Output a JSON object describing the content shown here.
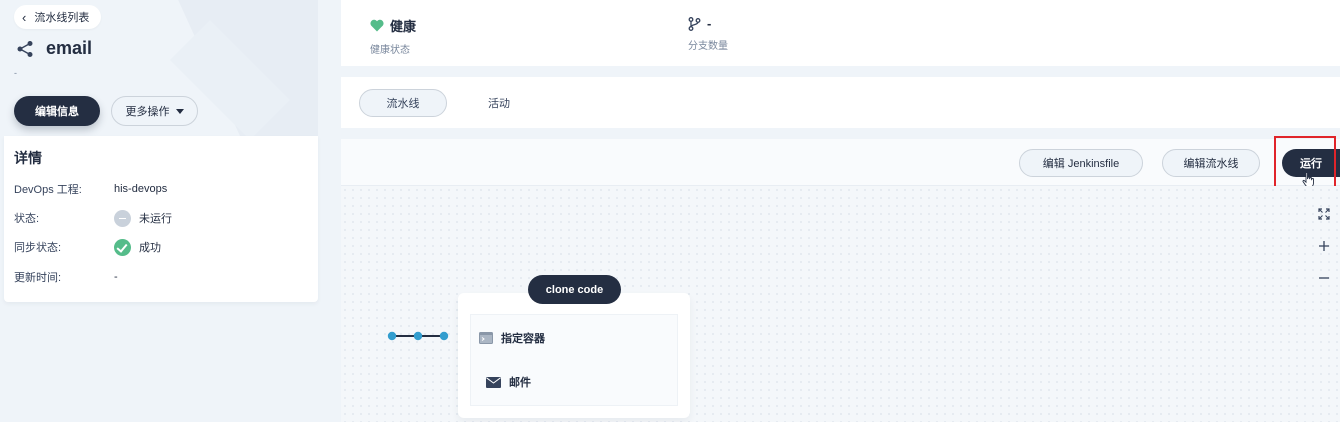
{
  "sidebar": {
    "back_label": "流水线列表",
    "pipeline_name": "email",
    "description": "-",
    "edit_button": "编辑信息",
    "more_button": "更多操作",
    "details": {
      "heading": "详情",
      "rows": [
        {
          "label": "DevOps 工程:",
          "value": "his-devops"
        },
        {
          "label": "状态:",
          "value": "未运行"
        },
        {
          "label": "同步状态:",
          "value": "成功"
        },
        {
          "label": "更新时间:",
          "value": "-"
        }
      ]
    }
  },
  "status": {
    "health": {
      "value": "健康",
      "label": "健康状态"
    },
    "branches": {
      "value": "-",
      "label": "分支数量"
    }
  },
  "tabs": [
    {
      "label": "流水线",
      "active": true
    },
    {
      "label": "活动",
      "active": false
    }
  ],
  "toolbar": {
    "edit_jenkinsfile": "编辑 Jenkinsfile",
    "edit_pipeline": "编辑流水线",
    "run": "运行"
  },
  "canvas": {
    "stage_name": "clone code",
    "steps": [
      {
        "label": "指定容器",
        "icon": "terminal-icon"
      },
      {
        "label": "邮件",
        "icon": "mail-icon"
      }
    ]
  },
  "colors": {
    "primary_dark": "#242e42",
    "success": "#55bc8a",
    "health": "#55bc8a",
    "highlight": "#e0242a"
  }
}
